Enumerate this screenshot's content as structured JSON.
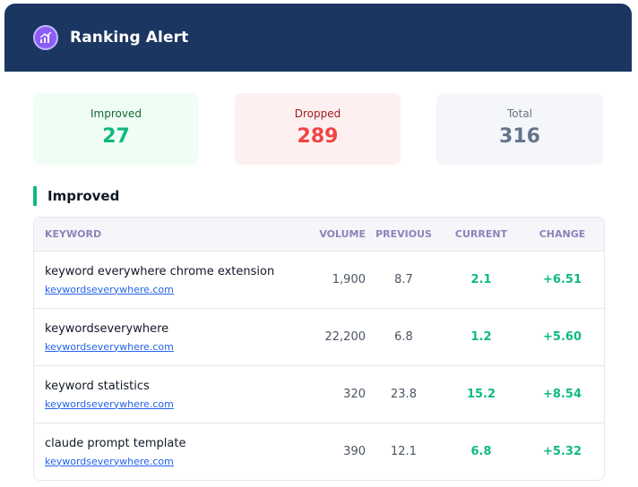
{
  "header": {
    "title": "Ranking Alert",
    "logo_icon": "chart-logo-icon"
  },
  "summary": {
    "improved": {
      "label": "Improved",
      "value": "27"
    },
    "dropped": {
      "label": "Dropped",
      "value": "289"
    },
    "total": {
      "label": "Total",
      "value": "316"
    }
  },
  "section": {
    "title": "Improved"
  },
  "table": {
    "headers": {
      "keyword": "KEYWORD",
      "volume": "VOLUME",
      "previous": "PREVIOUS",
      "current": "CURRENT",
      "change": "CHANGE"
    },
    "rows": [
      {
        "keyword": "keyword everywhere chrome extension",
        "domain": "keywordseverywhere.com",
        "volume": "1,900",
        "previous": "8.7",
        "current": "2.1",
        "change": "+6.51"
      },
      {
        "keyword": "keywordseverywhere",
        "domain": "keywordseverywhere.com",
        "volume": "22,200",
        "previous": "6.8",
        "current": "1.2",
        "change": "+5.60"
      },
      {
        "keyword": "keyword statistics",
        "domain": "keywordseverywhere.com",
        "volume": "320",
        "previous": "23.8",
        "current": "15.2",
        "change": "+8.54"
      },
      {
        "keyword": "claude prompt template",
        "domain": "keywordseverywhere.com",
        "volume": "390",
        "previous": "12.1",
        "current": "6.8",
        "change": "+5.32"
      }
    ]
  },
  "colors": {
    "header_bg": "#1b3661",
    "accent_green": "#10b981",
    "accent_red": "#ef4444",
    "logo": "#8b5cf6"
  }
}
